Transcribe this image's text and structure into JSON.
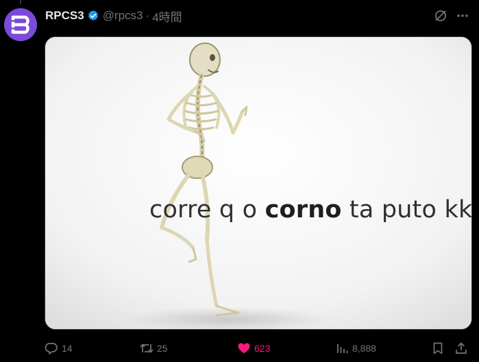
{
  "tweet": {
    "display_name": "RPCS3",
    "handle": "@rpcs3",
    "separator": "·",
    "time": "4時間",
    "verified": true,
    "avatar_icon": "rpcs3-logo-icon",
    "avatar_color": "#7b4ad9",
    "verified_color": "#1d9bf0"
  },
  "media": {
    "caption_part1": "corre q o ",
    "caption_bold": "corno",
    "caption_part2": " ta puto kk"
  },
  "actions": {
    "reply_count": "14",
    "retweet_count": "25",
    "like_count": "623",
    "like_active": true,
    "like_color": "#f91880",
    "views_count": "8,888"
  },
  "icons": [
    "grok-icon",
    "more-icon",
    "reply-icon",
    "retweet-icon",
    "heart-icon",
    "views-icon",
    "bookmark-icon",
    "share-icon"
  ]
}
